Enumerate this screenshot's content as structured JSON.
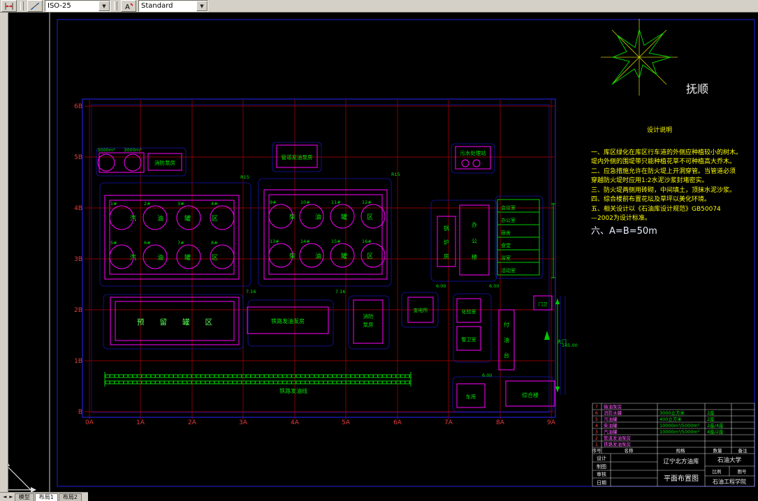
{
  "toolbar": {
    "dim_style_value": "ISO-25",
    "text_style_value": "Standard"
  },
  "icons": {
    "combo_arrow": "▼",
    "tab_prev": "◄",
    "tab_next": "►"
  },
  "tabs": {
    "model": "模型",
    "layout1": "布局1",
    "layout2": "布局2"
  },
  "plan": {
    "axis_cols": [
      "0A",
      "1A",
      "2A",
      "3A",
      "4A",
      "5A",
      "6A",
      "7A",
      "8A",
      "9A"
    ],
    "axis_rows": [
      "6B",
      "5B",
      "4B",
      "3B",
      "2B",
      "1B",
      "B"
    ],
    "tank_groups": {
      "left_label": "汽油罐区",
      "right_label": "柴油罐区"
    },
    "tank_ids_left": [
      "1#",
      "2#",
      "3#",
      "4#",
      "5#",
      "6#",
      "7#",
      "8#"
    ],
    "tank_ids_right": [
      "9#",
      "10#",
      "11#",
      "12#",
      "13#",
      "14#",
      "15#",
      "16#"
    ],
    "small_tank_label_1": "3000m³",
    "small_tank_label_2": "3000m³",
    "buildings": {
      "fire_pump_top": "消防泵房",
      "pipeline_pump": "管道发油泵房",
      "sewage": "污水处理站",
      "boiler_chars": [
        "锅",
        "炉",
        "房"
      ],
      "office_chars": [
        "办",
        "公",
        "楼"
      ],
      "reserved": "预留罐区",
      "rail_pump": "铁路发油泵房",
      "fire_pump_bottom_l1": "消防",
      "fire_pump_bottom_l2": "泵房",
      "substation": "变电所",
      "lab": "化验室",
      "guard": "警卫室",
      "loading_chars": [
        "付",
        "油",
        "台"
      ],
      "gatehouse": "门卫",
      "gate": "大门",
      "garage": "车库",
      "complex": "综合楼",
      "rooms": [
        "会议室",
        "办公室",
        "宿舍",
        "食堂",
        "浴室",
        "活动室"
      ],
      "railway": "铁路发油线"
    },
    "spots": [
      "7.16",
      "7.16",
      "R15",
      "R15",
      "6.00",
      "6.00",
      "6.00",
      "145.00"
    ]
  },
  "windrose": {
    "city": "抚顺"
  },
  "notes": {
    "title": "设计说明",
    "lines": [
      "一、库区绿化在库区行车道的外侧应种植较小的树木。",
      "堤内外侧的围堤带只能种植花草不可种植高大乔木。",
      "二、应急措施允许在防火堤上开洞穿管。当管道必须",
      "穿越防火堤时应用1:2水泥沙浆封堵密实。",
      "三、防火堤两侧用砖砌，中间填土，顶抹水泥沙浆。",
      "四、综合楼前布置花坛及草坪以美化环境。",
      "五、相关设计以《石油库设计规范》GB50074",
      "—2002为设计标准。"
    ],
    "final": "六、A=B=50m"
  },
  "title_block": {
    "project": "辽宁北方油库",
    "drawing_name": "平面布置图",
    "school": "石油大学",
    "college": "石油工程学院",
    "row_labels": [
      "设计",
      "制图",
      "审核",
      "日期"
    ],
    "scale_label": "比例",
    "no_label": "图号",
    "equipment": {
      "header": [
        "序号",
        "名称",
        "规格",
        "数量",
        "备注"
      ],
      "rows": [
        {
          "no": "7",
          "name": "输油泵房",
          "spec": "",
          "qty": ""
        },
        {
          "no": "6",
          "name": "消防水罐",
          "spec": "3000立方米",
          "qty": "2座"
        },
        {
          "no": "5",
          "name": "污油罐",
          "spec": "400立方米",
          "qty": "2座"
        },
        {
          "no": "4",
          "name": "柴油罐",
          "spec": "10000m³/5000m³",
          "qty": "2座/4座"
        },
        {
          "no": "3",
          "name": "汽油罐",
          "spec": "10000m³/5000m³",
          "qty": "4座/2座"
        },
        {
          "no": "2",
          "name": "管道发油泵房",
          "spec": "",
          "qty": ""
        },
        {
          "no": "1",
          "name": "铁路发油泵房",
          "spec": "",
          "qty": ""
        }
      ]
    }
  }
}
